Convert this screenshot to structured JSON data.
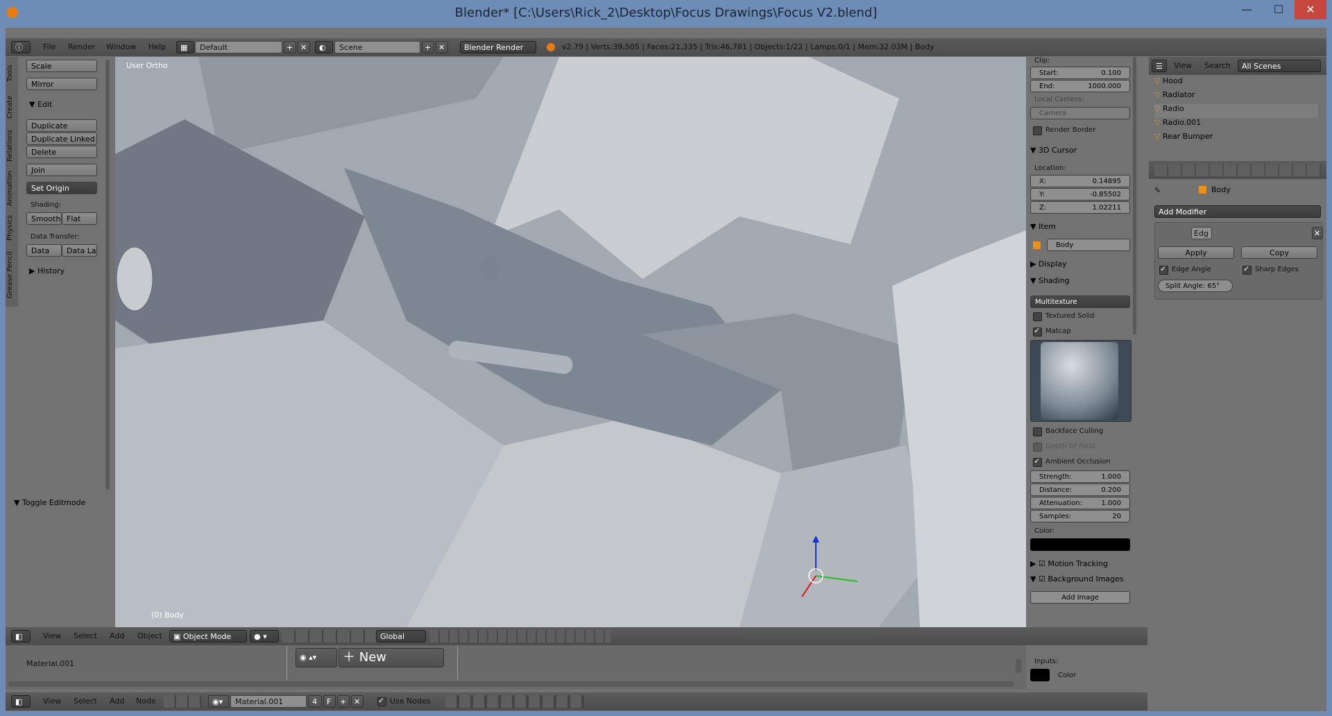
{
  "window": {
    "title": "Blender* [C:\\Users\\Rick_2\\Desktop\\Focus Drawings\\Focus V2.blend]",
    "minimize": "—",
    "maximize": "☐",
    "close": "✕"
  },
  "info_header": {
    "menus": [
      "File",
      "Render",
      "Window",
      "Help"
    ],
    "layout": "Default",
    "scene": "Scene",
    "engine": "Blender Render",
    "stats": "v2.79 | Verts:39,505 | Faces:21,335 | Tris:46,781 | Objects:1/22 | Lamps:0/1 | Mem:32.03M | Body"
  },
  "tool_shelf": {
    "tabs": [
      "Tools",
      "Create",
      "Relations",
      "Animation",
      "Physics",
      "Grease Pencil"
    ],
    "buttons_top": [
      "Scale",
      "Mirror"
    ],
    "edit_header": "Edit",
    "edit_buttons": [
      "Duplicate",
      "Duplicate Linked",
      "Delete",
      "Join"
    ],
    "set_origin": "Set Origin",
    "shading_label": "Shading:",
    "smooth": "Smooth",
    "flat": "Flat",
    "data_transfer_label": "Data Transfer:",
    "data": "Data",
    "data_la": "Data La",
    "history": "History",
    "toggle_editmode": "Toggle Editmode"
  },
  "viewport": {
    "view_label": "User Ortho",
    "object_label": "(0) Body"
  },
  "npanel": {
    "clip": "Clip:",
    "start_k": "Start:",
    "start_v": "0.100",
    "end_k": "End:",
    "end_v": "1000.000",
    "local_camera": "Local Camera:",
    "camera": "Camera",
    "render_border": "Render Border",
    "cursor_hdr": "3D Cursor",
    "location": "Location:",
    "x_k": "X:",
    "x_v": "0.14895",
    "y_k": "Y:",
    "y_v": "-0.85502",
    "z_k": "Z:",
    "z_v": "1.02211",
    "item_hdr": "Item",
    "item_name": "Body",
    "display_hdr": "Display",
    "shading_hdr": "Shading",
    "multitexture": "Multitexture",
    "textured_solid": "Textured Solid",
    "matcap": "Matcap",
    "backface": "Backface Culling",
    "dof": "Depth Of Field",
    "ao": "Ambient Occlusion",
    "strength_k": "Strength:",
    "strength_v": "1.000",
    "distance_k": "Distance:",
    "distance_v": "0.200",
    "atten_k": "Attenuation:",
    "atten_v": "1.000",
    "samples_k": "Samples:",
    "samples_v": "20",
    "color": "Color:",
    "motion_tracking": "Motion Tracking",
    "bg_images": "Background Images",
    "add_image": "Add Image"
  },
  "outliner": {
    "view": "View",
    "search": "Search",
    "scenes": "All Scenes",
    "rows": [
      "Hood",
      "Radiator",
      "Radio",
      "Radio.001",
      "Rear Bumper"
    ]
  },
  "properties": {
    "object": "Body",
    "add_modifier": "Add Modifier",
    "mod_name": "Edg",
    "apply": "Apply",
    "copy": "Copy",
    "edge_angle": "Edge Angle",
    "sharp_edges": "Sharp Edges",
    "split_angle": "Split Angle: 65°"
  },
  "viewport_header": {
    "menus": [
      "View",
      "Select",
      "Add",
      "Object"
    ],
    "mode": "Object Mode",
    "orientation": "Global"
  },
  "node_editor": {
    "material_label": "Material.001",
    "new": "New",
    "inputs": "Inputs:",
    "color": "Color"
  },
  "node_header": {
    "menus": [
      "View",
      "Select",
      "Add",
      "Node"
    ],
    "material": "Material.001",
    "users": "4",
    "fake": "F",
    "use_nodes": "Use Nodes"
  }
}
